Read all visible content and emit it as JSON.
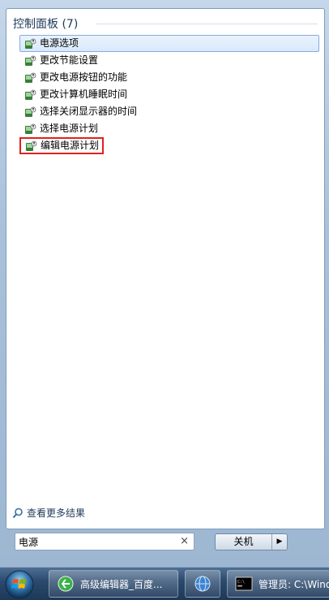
{
  "start_menu": {
    "group_header": "控制面板 (7)",
    "results": [
      {
        "label": "电源选项",
        "state": "selected"
      },
      {
        "label": "更改节能设置",
        "state": "normal"
      },
      {
        "label": "更改电源按钮的功能",
        "state": "normal"
      },
      {
        "label": "更改计算机睡眠时间",
        "state": "normal"
      },
      {
        "label": "选择关闭显示器的时间",
        "state": "normal"
      },
      {
        "label": "选择电源计划",
        "state": "normal"
      },
      {
        "label": "编辑电源计划",
        "state": "highlighted"
      }
    ],
    "more_results": "查看更多结果",
    "search": {
      "value": "电源",
      "clear_icon": "×"
    },
    "shutdown": {
      "label": "关机",
      "arrow": "▶"
    }
  },
  "taskbar": {
    "tasks": [
      {
        "label": "高级编辑器_百度...",
        "icon": "ie-icon"
      },
      {
        "label": "",
        "icon": "globe-icon"
      },
      {
        "label": "管理员: C:\\Wind",
        "icon": "cmd-icon"
      }
    ]
  },
  "colors": {
    "highlight_border": "#e02020",
    "selected_bg": "#d9e9fb",
    "header_text": "#1e395b"
  }
}
